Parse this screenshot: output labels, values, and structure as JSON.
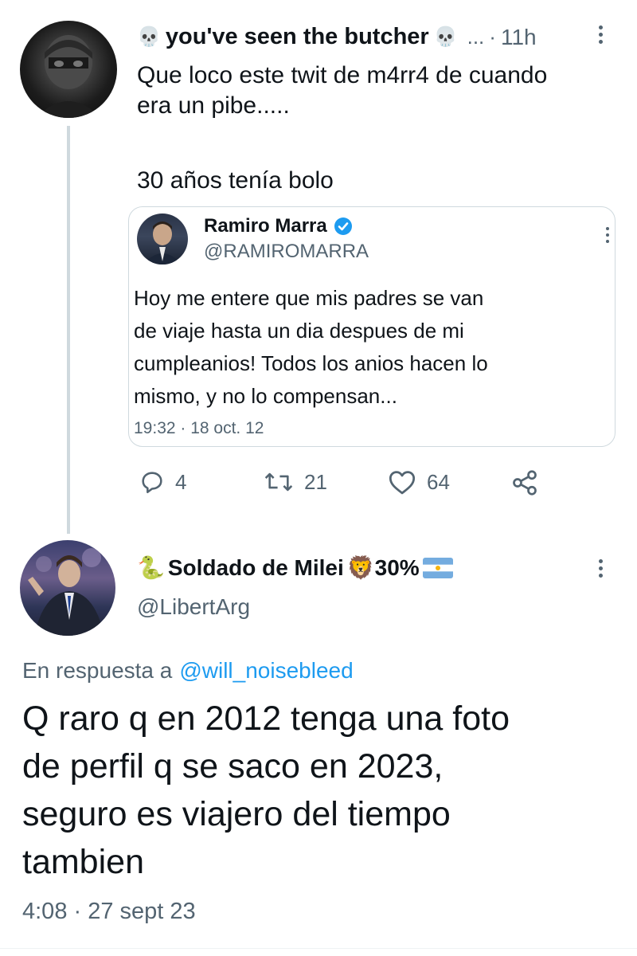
{
  "main_tweet": {
    "avatar_icon": "masked-person-avatar",
    "name_prefix_emoji": "💀",
    "name": "you've seen the butcher",
    "name_suffix_emoji": "💀",
    "handle_truncated": "...",
    "separator": "·",
    "time": "11h",
    "text_line1": "Que loco este twit de m4rr4 de cuando",
    "text_line2": "era un pibe.....",
    "text_line3": "30 años tenía bolo",
    "quoted": {
      "name": "Ramiro Marra",
      "verified": true,
      "handle": "@RAMIROMARRA",
      "text_lines": [
        "Hoy me entere que mis padres se van",
        "de viaje hasta un dia despues de mi",
        "cumpleanios! Todos los anios hacen lo",
        "mismo, y no lo compensan..."
      ],
      "timestamp": "19:32 · 18 oct. 12"
    },
    "actions": {
      "replies": "4",
      "retweets": "21",
      "likes": "64"
    }
  },
  "reply_tweet": {
    "name_prefix_emoji": "🐍",
    "name": "Soldado de Milei",
    "name_suffix": "🦁30%",
    "flag_icon": "argentina-flag-icon",
    "handle": "@LibertArg",
    "in_reply_prefix": "En respuesta a",
    "in_reply_handle": "@will_noisebleed",
    "text_lines": [
      "Q raro q en 2012 tenga una foto",
      "de perfil q se saco en 2023,",
      "seguro es viajero del tiempo",
      "tambien"
    ],
    "timestamp": "4:08 · 27 sept 23"
  },
  "colors": {
    "text": "#0f1419",
    "muted": "#536471",
    "link": "#1d9bf0",
    "border": "#cfd9de",
    "verified": "#1d9bf0"
  }
}
